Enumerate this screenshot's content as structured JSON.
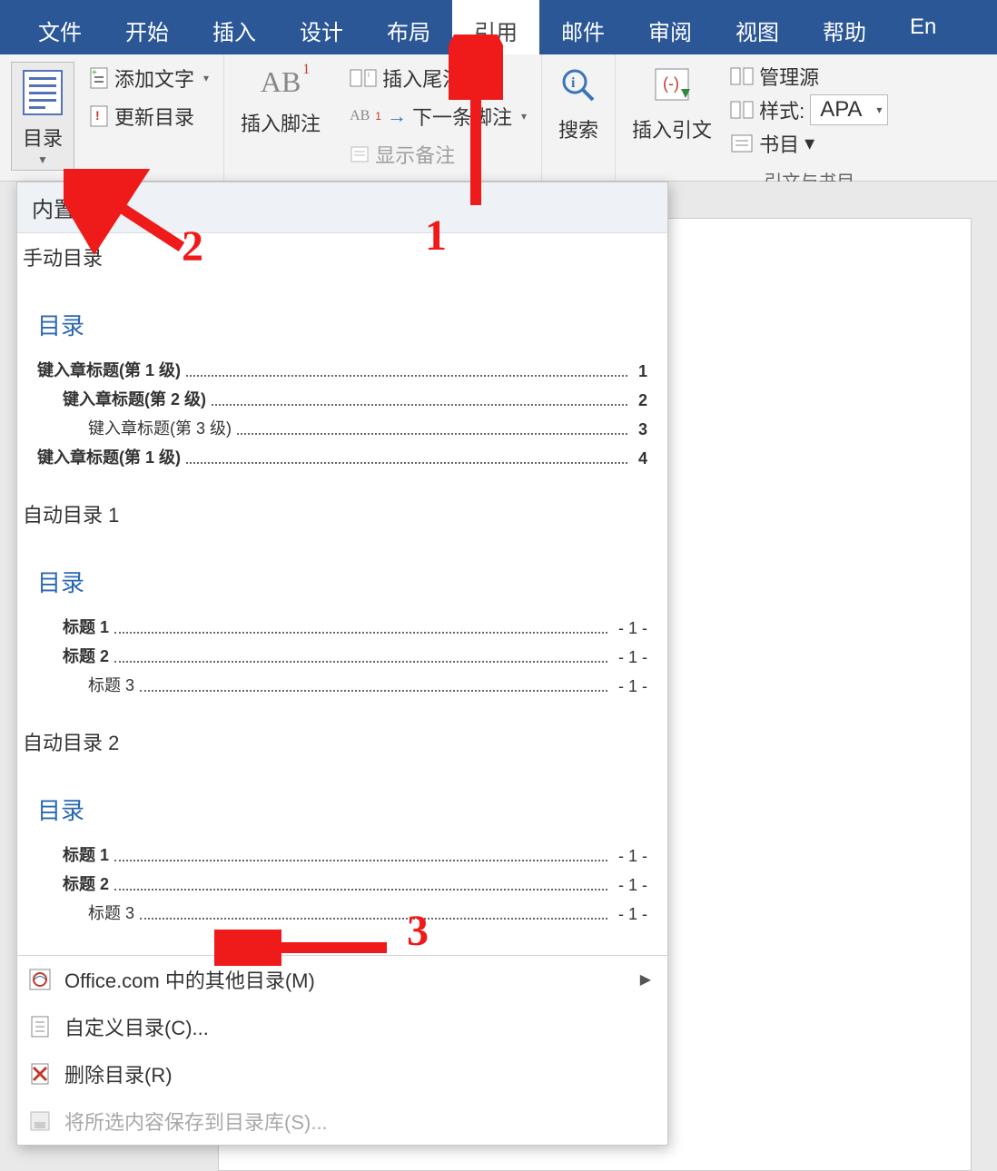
{
  "tabs": {
    "file": "文件",
    "home": "开始",
    "insert": "插入",
    "design": "设计",
    "layout": "布局",
    "references": "引用",
    "mailings": "邮件",
    "review": "审阅",
    "view": "视图",
    "help": "帮助",
    "end": "En"
  },
  "ribbon": {
    "toc": "目录",
    "add_text": "添加文字",
    "update_toc": "更新目录",
    "insert_footnote": "插入脚注",
    "ab_super": "1",
    "insert_endnote": "插入尾注",
    "next_footnote": "下一条脚注",
    "show_notes": "显示备注",
    "search": "搜索",
    "insert_citation": "插入引文",
    "manage_sources": "管理源",
    "style_label": "样式:",
    "style_value": "APA",
    "bibliography": "书目",
    "cite_group": "引文与书目"
  },
  "dropdown": {
    "builtin": "内置",
    "cat_manual": "手动目录",
    "cat_auto1": "自动目录 1",
    "cat_auto2": "自动目录 2",
    "toc_title": "目录",
    "manual": {
      "l1a": "键入章标题(第 1 级)",
      "l1a_n": "1",
      "l2": "键入章标题(第 2 级)",
      "l2_n": "2",
      "l3": "键入章标题(第 3 级)",
      "l3_n": "3",
      "l1b": "键入章标题(第 1 级)",
      "l1b_n": "4"
    },
    "auto": {
      "h1": "标题 1",
      "h1_n": "- 1 -",
      "h2": "标题 2",
      "h2_n": "- 1 -",
      "h3": "标题 3",
      "h3_n": "- 1 -"
    },
    "more_office": "Office.com 中的其他目录(M)",
    "custom_toc": "自定义目录(C)...",
    "remove_toc": "删除目录(R)",
    "save_selection": "将所选内容保存到目录库(S)..."
  },
  "annotations": {
    "n1": "1",
    "n2": "2",
    "n3": "3"
  }
}
